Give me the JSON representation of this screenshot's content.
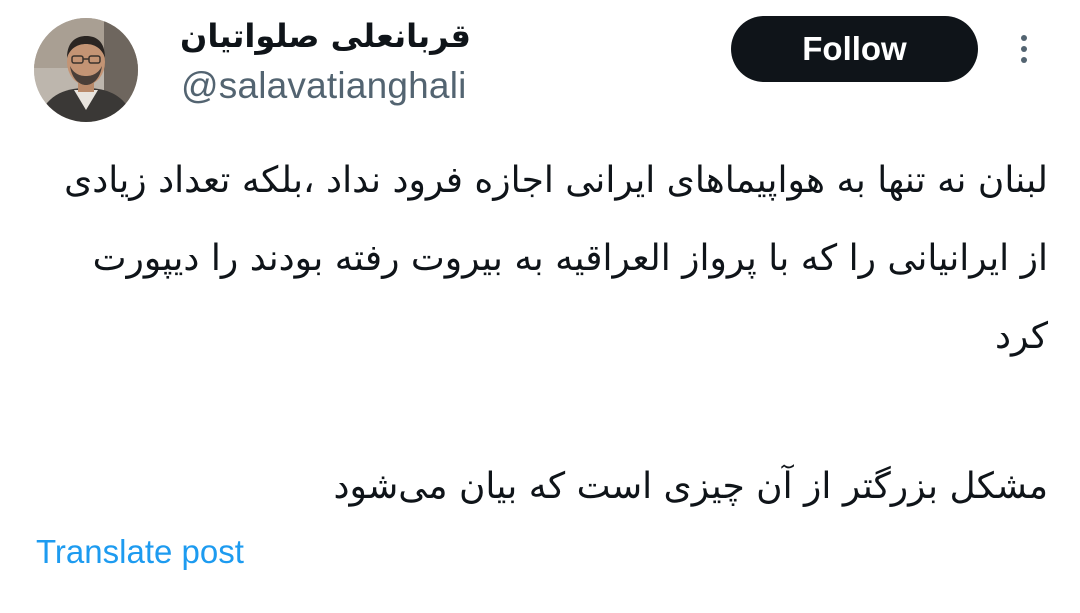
{
  "author": {
    "display_name": "قربانعلی صلواتیان",
    "handle": "@salavatianghali",
    "avatar_icon": "profile-photo"
  },
  "actions": {
    "follow_label": "Follow",
    "more_icon": "more-vertical-icon"
  },
  "post": {
    "paragraph_1": "لبنان نه تنها به هواپیماهای ایرانی اجازه فرود نداد ،بلکه تعداد زیادی از ایرانیانی را که با پرواز العراقیه به بیروت رفته بودند را دیپورت کرد",
    "paragraph_2": "مشکل بزرگتر از آن چیزی است که بیان می‌شود"
  },
  "translate_label": "Translate post",
  "colors": {
    "follow_bg": "#0f1419",
    "link": "#1d9bf0",
    "handle": "#536471",
    "text": "#0f1419"
  }
}
